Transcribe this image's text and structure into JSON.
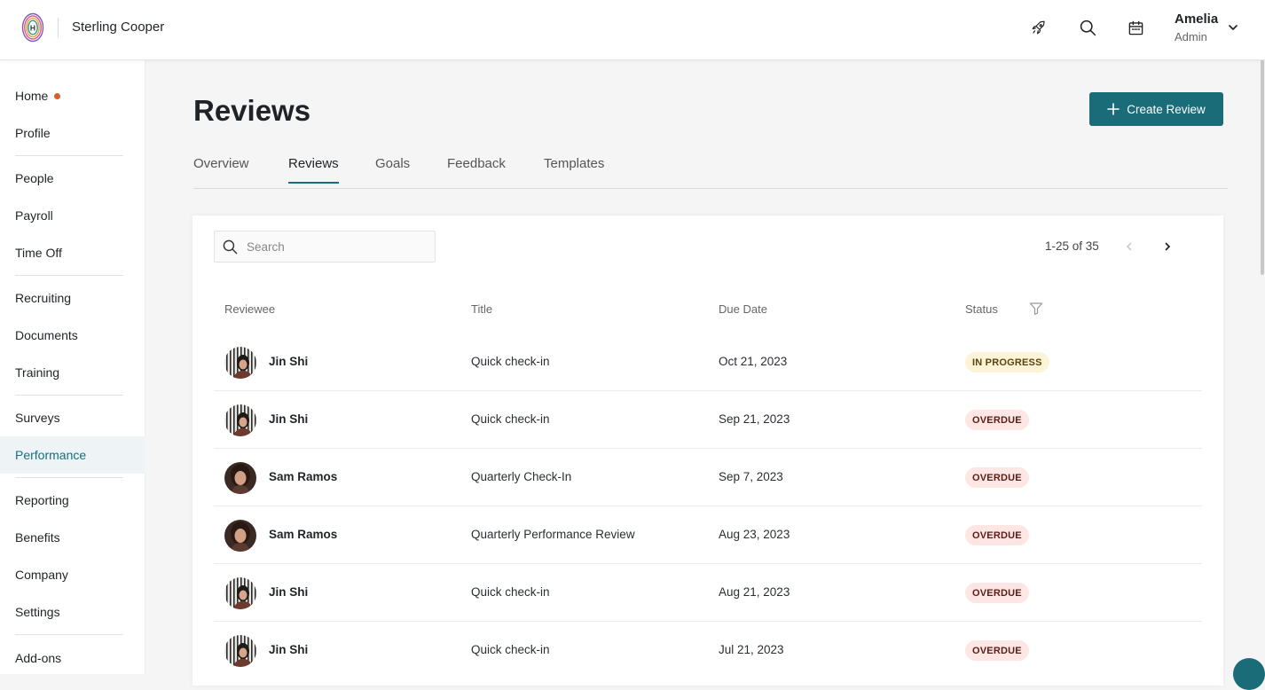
{
  "brand": {
    "name": "Sterling Cooper"
  },
  "user": {
    "name": "Amelia",
    "role": "Admin"
  },
  "sidebar": {
    "items": [
      {
        "label": "Home",
        "dot": true
      },
      {
        "label": "Profile"
      },
      {
        "label": "People"
      },
      {
        "label": "Payroll"
      },
      {
        "label": "Time Off"
      },
      {
        "label": "Recruiting"
      },
      {
        "label": "Documents"
      },
      {
        "label": "Training"
      },
      {
        "label": "Surveys"
      },
      {
        "label": "Performance",
        "active": true
      },
      {
        "label": "Reporting"
      },
      {
        "label": "Benefits"
      },
      {
        "label": "Company"
      },
      {
        "label": "Settings"
      },
      {
        "label": "Add-ons"
      }
    ]
  },
  "page": {
    "title": "Reviews",
    "create_label": "Create Review"
  },
  "tabs": [
    {
      "label": "Overview"
    },
    {
      "label": "Reviews",
      "active": true
    },
    {
      "label": "Goals"
    },
    {
      "label": "Feedback"
    },
    {
      "label": "Templates"
    }
  ],
  "search": {
    "placeholder": "Search"
  },
  "pagination": {
    "text": "1-25 of 35"
  },
  "table": {
    "headers": {
      "reviewee": "Reviewee",
      "title": "Title",
      "due": "Due Date",
      "status": "Status"
    },
    "rows": [
      {
        "name": "Jin Shi",
        "title": "Quick check-in",
        "due": "Oct 21, 2023",
        "status": "IN PROGRESS",
        "avatar": "jin"
      },
      {
        "name": "Jin Shi",
        "title": "Quick check-in",
        "due": "Sep 21, 2023",
        "status": "OVERDUE",
        "avatar": "jin"
      },
      {
        "name": "Sam Ramos",
        "title": "Quarterly Check-In",
        "due": "Sep 7, 2023",
        "status": "OVERDUE",
        "avatar": "sam"
      },
      {
        "name": "Sam Ramos",
        "title": "Quarterly Performance Review",
        "due": "Aug 23, 2023",
        "status": "OVERDUE",
        "avatar": "sam"
      },
      {
        "name": "Jin Shi",
        "title": "Quick check-in",
        "due": "Aug 21, 2023",
        "status": "OVERDUE",
        "avatar": "jin"
      },
      {
        "name": "Jin Shi",
        "title": "Quick check-in",
        "due": "Jul 21, 2023",
        "status": "OVERDUE",
        "avatar": "jin"
      }
    ]
  },
  "colors": {
    "accent": "#1a6d78",
    "active_nav_bg": "#eef4f5",
    "dot": "#e05a2b",
    "in_progress_bg": "#fdf3d7",
    "overdue_bg": "#fde6e4"
  }
}
